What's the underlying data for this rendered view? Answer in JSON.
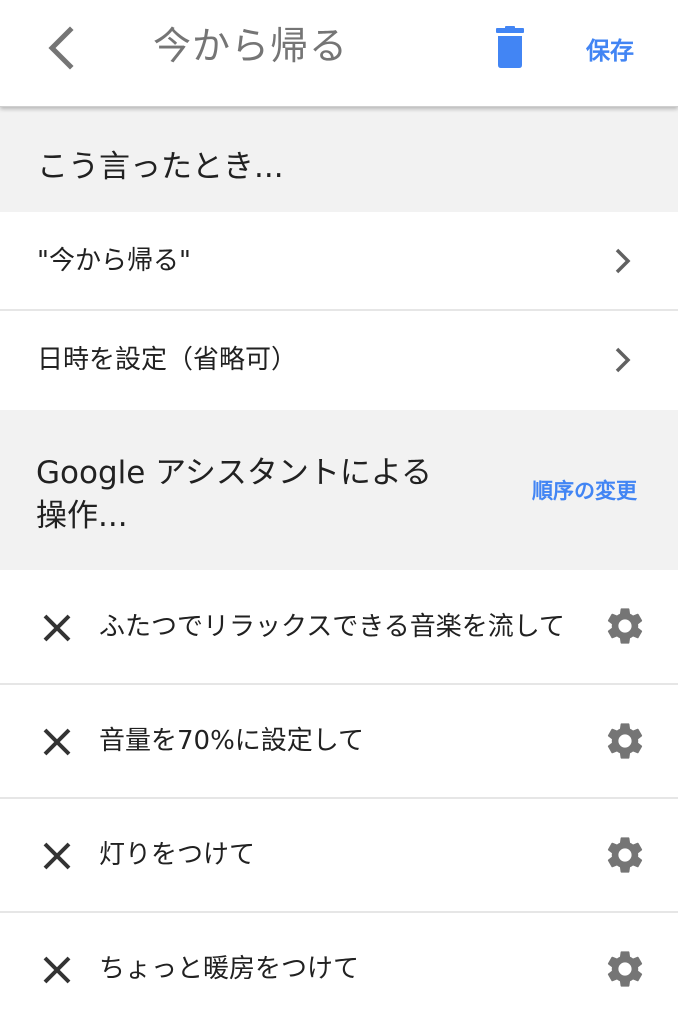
{
  "header": {
    "title": "今から帰る",
    "save_label": "保存",
    "back_icon": "chevron-left-icon",
    "delete_icon": "trash-icon"
  },
  "colors": {
    "accent": "#4285f4",
    "icon_gray": "#757575",
    "section_bg": "#f2f2f2"
  },
  "when_said": {
    "title": "こう言ったとき...",
    "rows": [
      {
        "label": "\"今から帰る\""
      },
      {
        "label": "日時を設定（省略可）"
      }
    ]
  },
  "assistant_actions": {
    "title": "Google アシスタントによる操作...",
    "reorder_label": "順序の変更",
    "actions": [
      {
        "label": "ふたつでリラックスできる音楽を流して"
      },
      {
        "label": "音量を70%に設定して"
      },
      {
        "label": "灯りをつけて"
      },
      {
        "label": "ちょっと暖房をつけて"
      }
    ]
  }
}
